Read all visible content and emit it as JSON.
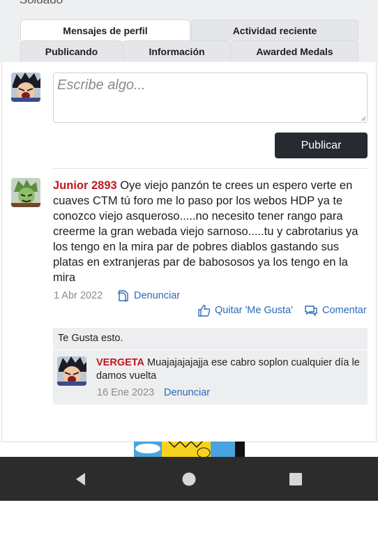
{
  "header": {
    "partial_title": "Soldado"
  },
  "tabs": {
    "row1": [
      "Mensajes de perfil",
      "Actividad reciente"
    ],
    "row2": [
      "Publicando",
      "Información",
      "Awarded Medals"
    ]
  },
  "composer": {
    "placeholder": "Escribe algo...",
    "publish_label": "Publicar"
  },
  "post": {
    "author": "Junior 2893",
    "body": " Oye viejo panzón te crees un espero verte en cuaves CTM tú foro me lo paso por los webos HDP ya te conozco viejo asqueroso.....no necesito tener rango para creerme la gran webada viejo sarnoso.....tu y cabrotarius ya los tengo en la mira par de pobres diablos gastando sus platas en extranjeras par de babososos ya los tengo en la mira",
    "date": "1 Abr 2022",
    "report_label": "Denunciar",
    "unlike_label": "Quitar 'Me Gusta'",
    "comment_label": "Comentar",
    "likes_text": "Te Gusta esto."
  },
  "comment": {
    "author": "VERGETA",
    "body": " Muajajajajajja ese cabro soplon cualquier día le damos vuelta",
    "date": "16 Ene 2023",
    "report_label": "Denunciar"
  },
  "icons": {
    "report": "report-icon",
    "like": "thumbs-up-icon",
    "comment": "comment-bubble-icon",
    "back": "back-triangle-icon",
    "home": "home-circle-icon",
    "recents": "recents-square-icon"
  },
  "colors": {
    "username": "#c0161e",
    "link": "#2a6bb5",
    "button_bg": "#272a30",
    "navbar_bg": "#2c2c2c"
  }
}
